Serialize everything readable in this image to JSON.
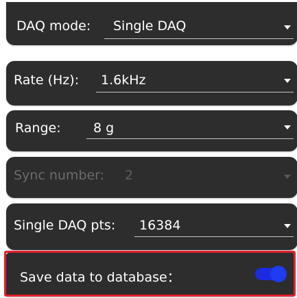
{
  "fields": {
    "daq_mode": {
      "label": "DAQ mode:",
      "value": "Single DAQ"
    },
    "rate": {
      "label": "Rate (Hz):",
      "value": "1.6kHz"
    },
    "range": {
      "label": "Range:",
      "value": "8 g"
    },
    "sync_number": {
      "label": "Sync number:",
      "value": "2",
      "disabled": true
    },
    "single_daq_pts": {
      "label": "Single DAQ pts:",
      "value": "16384"
    }
  },
  "save_data": {
    "label": "Save data to database：",
    "enabled": true
  },
  "colors": {
    "card_bg": "#2d2d2d",
    "highlight": "#e3202a",
    "toggle_on": "#1e3cf2"
  }
}
